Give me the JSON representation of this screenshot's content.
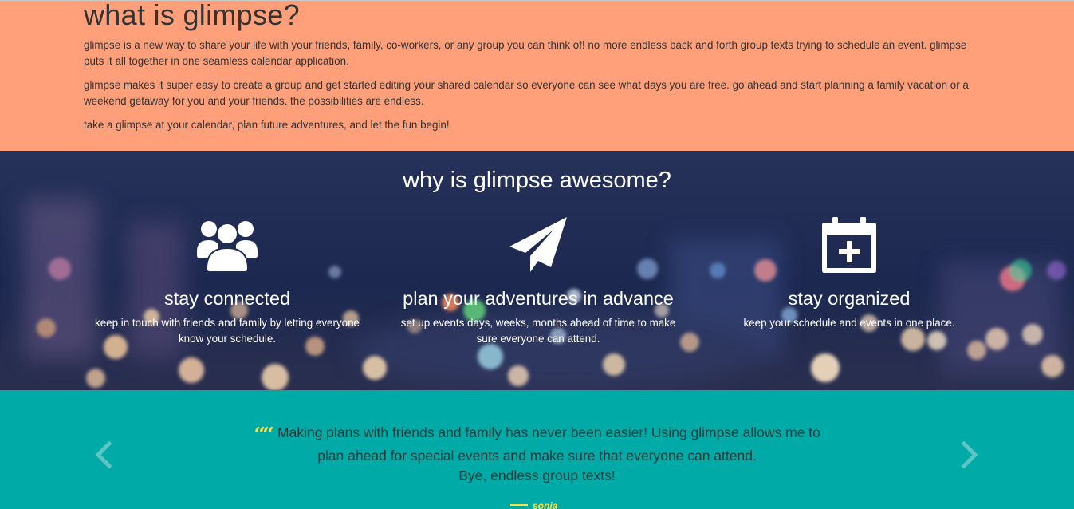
{
  "about": {
    "title": "what is glimpse?",
    "paragraphs": [
      "glimpse is a new way to share your life with your friends, family, co-workers, or any group you can think of! no more endless back and forth group texts trying to schedule an event. glimpse puts it all together in one seamless calendar application.",
      "glimpse makes it super easy to create a group and get started editing your shared calendar so everyone can see what days you are free. go ahead and start planning a family vacation or a weekend getaway for you and your friends. the possibilities are endless.",
      "take a glimpse at your calendar, plan future adventures, and let the fun begin!"
    ]
  },
  "features": {
    "title": "why is glimpse awesome?",
    "items": [
      {
        "icon": "group-icon",
        "heading": "stay connected",
        "text": "keep in touch with friends and family by letting everyone know your schedule."
      },
      {
        "icon": "paper-plane-icon",
        "heading": "plan your adventures in advance",
        "text": "set up events days, weeks, months ahead of time to make sure everyone can attend."
      },
      {
        "icon": "calendar-plus-icon",
        "heading": "stay organized",
        "text": "keep your schedule and events in one place."
      }
    ]
  },
  "testimonial": {
    "quote_lines": [
      "Making plans with friends and family has never been easier! Using glimpse allows me to",
      "plan ahead for special events and make sure that everyone can attend.",
      "Bye, endless group texts!"
    ],
    "author": "sonia",
    "prev_icon": "chevron-left-icon",
    "next_icon": "chevron-right-icon"
  },
  "colors": {
    "about_bg": "#ffa07a",
    "features_bg": "#1f2c52",
    "testimonial_bg": "#00aaa6",
    "accent_yellow": "#f5e04a"
  }
}
